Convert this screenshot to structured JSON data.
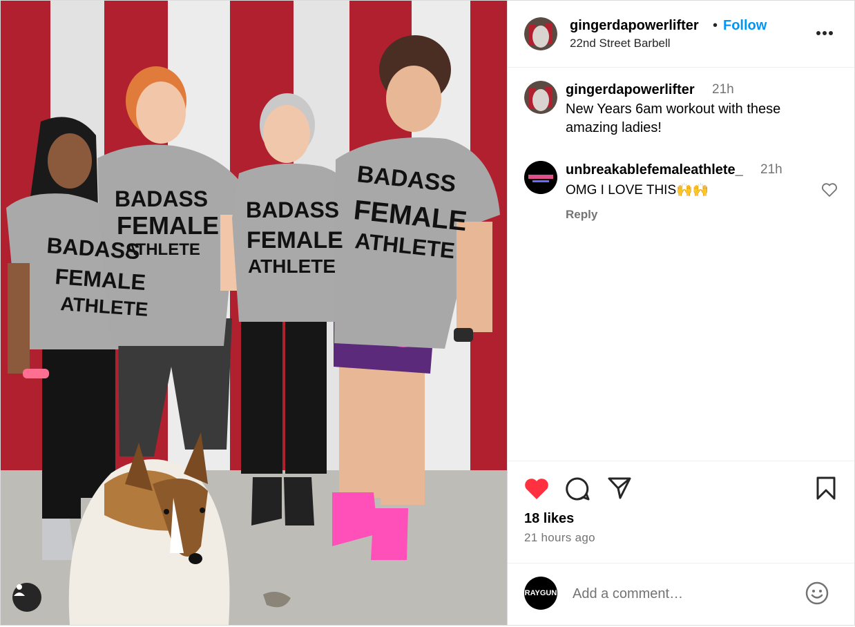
{
  "post": {
    "author": "gingerdapowerlifter",
    "separator": "•",
    "follow_label": "Follow",
    "location": "22nd Street Barbell"
  },
  "photo": {
    "shirt_lines": [
      "BADASS",
      "FEMALE",
      "ATHLETE"
    ]
  },
  "caption": {
    "user": "gingerdapowerlifter",
    "time": "21h",
    "text": "New Years 6am workout with these amazing ladies!"
  },
  "comments": [
    {
      "user": "unbreakablefemaleathlete_",
      "time": "21h",
      "text": "OMG I LOVE THIS🙌🙌",
      "reply_label": "Reply"
    }
  ],
  "stats": {
    "likes": "18 likes",
    "time_ago": "21 hours ago"
  },
  "composer": {
    "placeholder": "Add a comment…",
    "my_avatar_text": "RAYGUN"
  },
  "icons": {
    "like": "heart-filled-icon",
    "comment": "comment-bubble-icon",
    "share": "paper-plane-icon",
    "save": "bookmark-icon",
    "more": "more-options-icon",
    "emoji": "emoji-smile-icon",
    "tagged": "user-tag-icon",
    "comment_like": "heart-outline-icon"
  },
  "colors": {
    "like_red": "#ff3040",
    "link_blue": "#0095f6",
    "muted_text": "#737373",
    "flag_red": "#b0202e",
    "flag_white": "#ececec",
    "shirt_grey": "#a8a8a8",
    "shorts_purple": "#5b2a7a",
    "shoes_pink": "#ff4fb8"
  }
}
